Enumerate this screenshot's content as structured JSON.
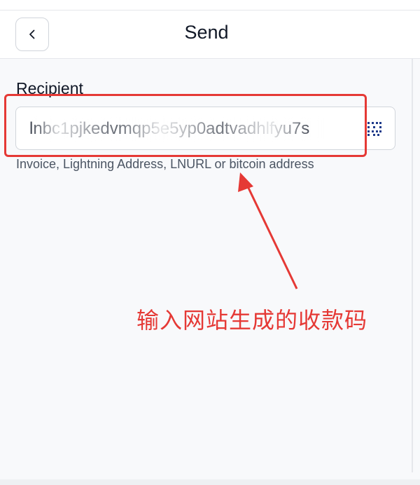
{
  "header": {
    "title": "Send",
    "back_icon": "chevron-left-icon"
  },
  "recipient": {
    "label": "Recipient",
    "value": "lnbc1pjkedvmqp5e5yp0adtvadhlfyu7s",
    "helper": "Invoice, Lightning Address, LNURL or bitcoin address",
    "scan_icon": "qr-code-icon"
  },
  "annotation": {
    "text": "输入网站生成的收款码",
    "color": "#e53935"
  }
}
